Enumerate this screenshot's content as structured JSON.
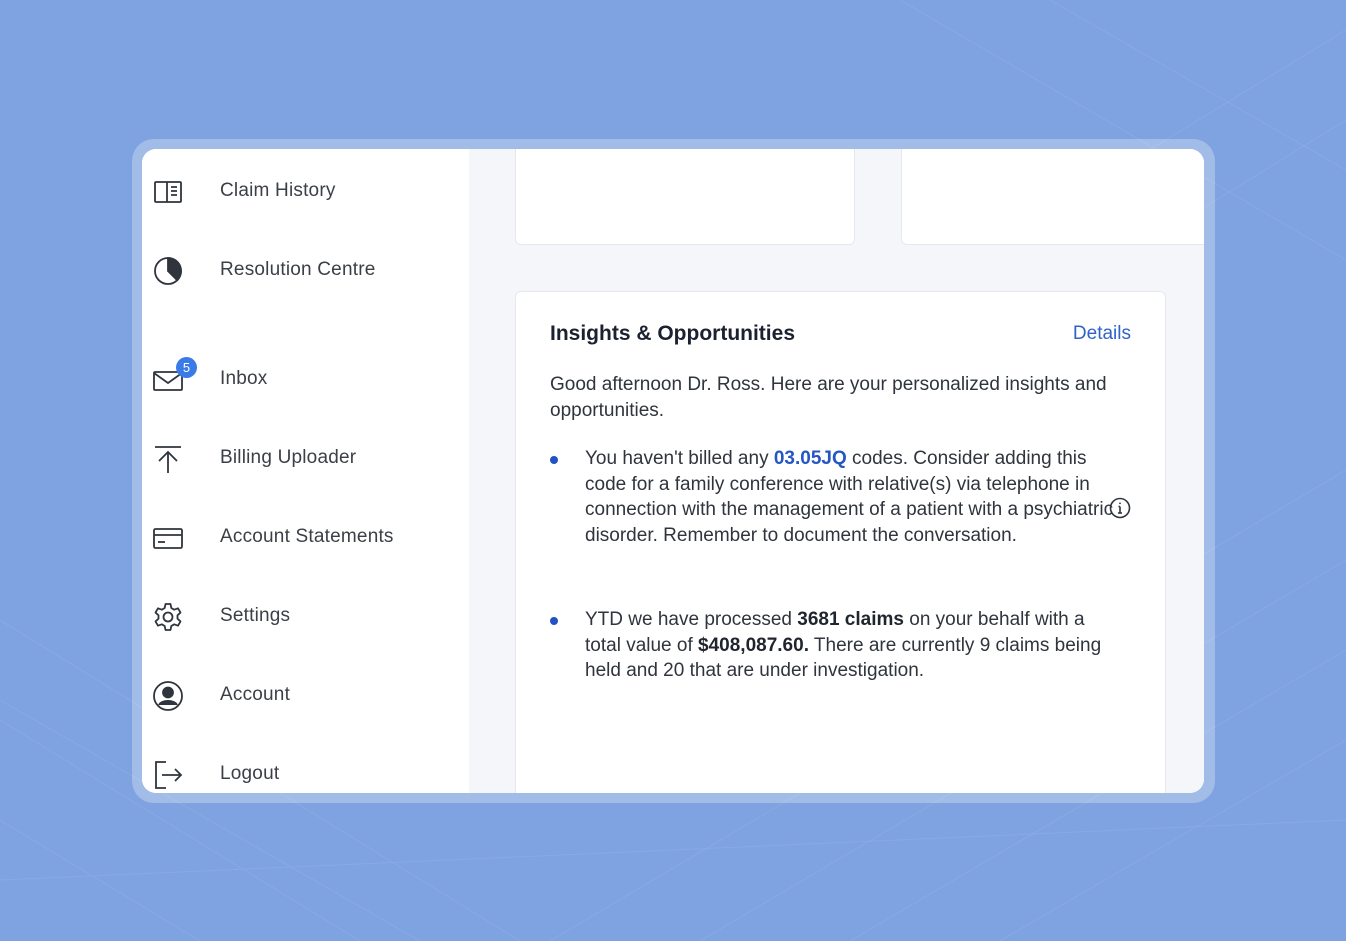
{
  "colors": {
    "background": "#7fa2e0",
    "accent": "#2e63c8",
    "badge": "#3b7be8",
    "bullet": "#2352c4"
  },
  "sidebar": {
    "items": [
      {
        "label": "Claim History",
        "icon": "claim-history-icon"
      },
      {
        "label": "Resolution Centre",
        "icon": "pie-chart-icon"
      },
      {
        "label": "Inbox",
        "icon": "envelope-icon",
        "badge": "5"
      },
      {
        "label": "Billing Uploader",
        "icon": "upload-arrow-icon"
      },
      {
        "label": "Account Statements",
        "icon": "credit-card-icon"
      },
      {
        "label": "Settings",
        "icon": "gear-icon"
      },
      {
        "label": "Account",
        "icon": "user-circle-icon"
      },
      {
        "label": "Logout",
        "icon": "logout-icon"
      }
    ]
  },
  "insights": {
    "title": "Insights & Opportunities",
    "details_label": "Details",
    "greeting": "Good afternoon Dr. Ross. Here are your personalized insights and opportunities.",
    "item1": {
      "pre": "You haven't billed any ",
      "code": "03.05JQ",
      "post": " codes. Consider adding this code for a family conference with relative(s) via telephone in connection with the management of a patient with a psychiatric disorder. Remember to document the conversation.",
      "info_icon": "info-icon"
    },
    "item2": {
      "pre": "YTD we have processed ",
      "claims": "3681 claims",
      "mid": " on your behalf with a total value of ",
      "value": "$408,087.60.",
      "post": " There are currently 9 claims being held and 20 that are under investigation."
    }
  }
}
